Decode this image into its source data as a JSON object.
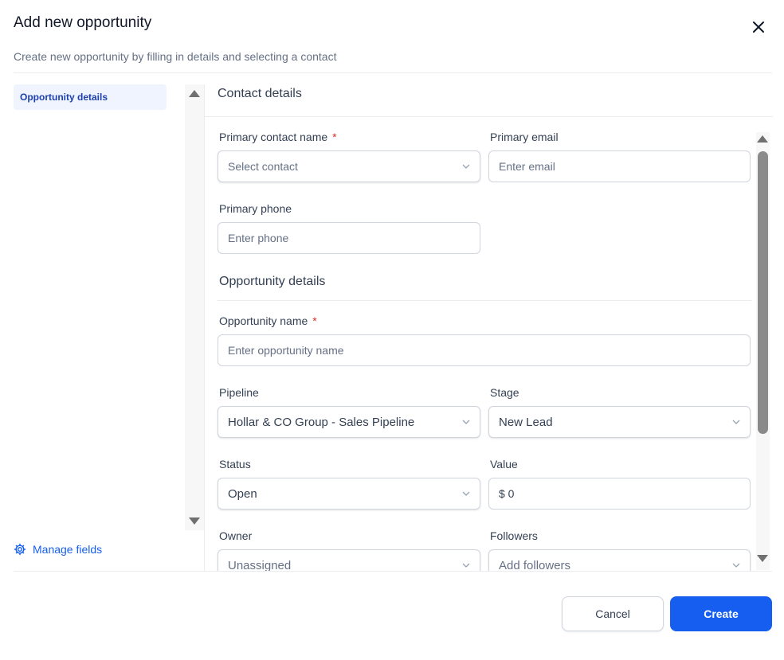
{
  "modal": {
    "title": "Add new opportunity",
    "subtitle": "Create new opportunity by filling in details and selecting a contact"
  },
  "sidebar": {
    "items": [
      {
        "label": "Opportunity details",
        "active": true
      }
    ],
    "manage_fields_label": "Manage fields"
  },
  "contact_section": {
    "title": "Contact details",
    "primary_contact": {
      "label": "Primary contact name",
      "required": "*",
      "placeholder": "Select contact"
    },
    "primary_email": {
      "label": "Primary email",
      "placeholder": "Enter email"
    },
    "primary_phone": {
      "label": "Primary phone",
      "placeholder": "Enter phone"
    }
  },
  "opportunity_section": {
    "title": "Opportunity details",
    "name": {
      "label": "Opportunity name",
      "required": "*",
      "placeholder": "Enter opportunity name"
    },
    "pipeline": {
      "label": "Pipeline",
      "value": "Hollar & CO Group - Sales Pipeline"
    },
    "stage": {
      "label": "Stage",
      "value": "New Lead"
    },
    "status": {
      "label": "Status",
      "value": "Open"
    },
    "value": {
      "label": "Value",
      "value": "$ 0"
    },
    "owner": {
      "label": "Owner",
      "value": "Unassigned"
    },
    "followers": {
      "label": "Followers",
      "placeholder": "Add followers"
    }
  },
  "footer": {
    "cancel_label": "Cancel",
    "create_label": "Create"
  },
  "colors": {
    "primary": "#155eef",
    "nav_active_bg": "#eff4ff",
    "required": "#d92d20"
  }
}
